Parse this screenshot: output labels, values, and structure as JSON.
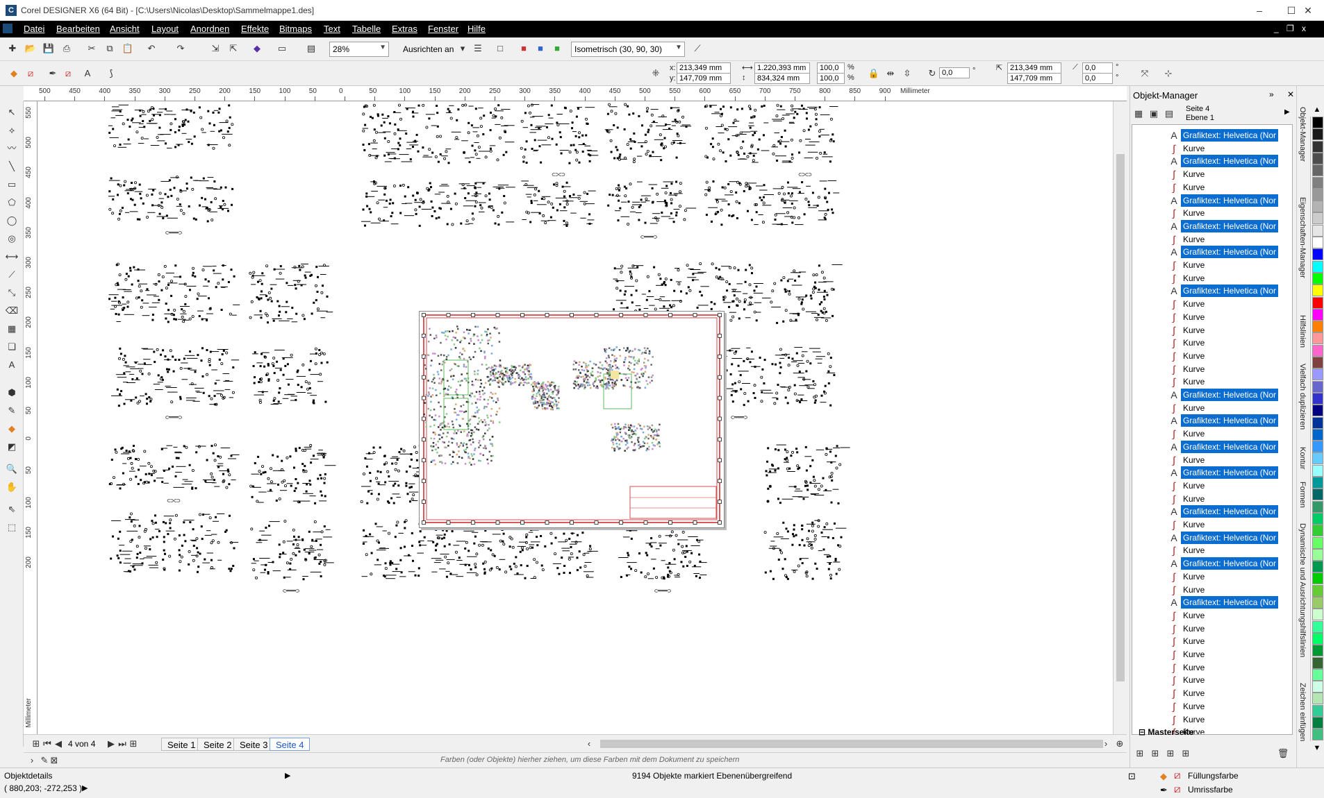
{
  "app": {
    "title": "Corel DESIGNER X6 (64 Bit) - [C:\\Users\\Nicolas\\Desktop\\Sammelmappe1.des]",
    "logo": "corel-logo"
  },
  "window_controls": {
    "minimize": "–",
    "maximize": "☐",
    "close": "✕"
  },
  "mdi_controls": {
    "minimize": "_",
    "restore": "❐",
    "close": "x"
  },
  "menu": [
    {
      "label": "Datei"
    },
    {
      "label": "Bearbeiten"
    },
    {
      "label": "Ansicht"
    },
    {
      "label": "Layout"
    },
    {
      "label": "Anordnen"
    },
    {
      "label": "Effekte"
    },
    {
      "label": "Bitmaps"
    },
    {
      "label": "Text"
    },
    {
      "label": "Tabelle"
    },
    {
      "label": "Extras"
    },
    {
      "label": "Fenster"
    },
    {
      "label": "Hilfe"
    }
  ],
  "toolbar": {
    "zoom": "28%",
    "align_label": "Ausrichten an",
    "projection": "Isometrisch (30, 90, 30)"
  },
  "propbar": {
    "x": "213,349 mm",
    "y": "147,709 mm",
    "width": "1.220,393 mm",
    "height": "834,324 mm",
    "scale_x": "100,0",
    "scale_y": "100,0",
    "percent": "%",
    "rotation": "0,0",
    "degree": "°",
    "pos2_x": "213,349 mm",
    "pos2_y": "147,709 mm",
    "skew_x": "0,0",
    "skew_y": "0,0",
    "x_label": "x:",
    "y_label": "y:"
  },
  "ruler": {
    "h_labels": [
      "500",
      "450",
      "400",
      "350",
      "300",
      "250",
      "200",
      "150",
      "100",
      "50",
      "0",
      "50",
      "100",
      "150",
      "200",
      "250",
      "300",
      "350",
      "400",
      "450",
      "500",
      "550",
      "600",
      "650",
      "700",
      "750",
      "800",
      "850",
      "900"
    ],
    "h_unit": "Millimeter",
    "v_labels": [
      "550",
      "500",
      "450",
      "400",
      "350",
      "300",
      "250",
      "200",
      "150",
      "100",
      "50",
      "0",
      "50",
      "100",
      "150",
      "200"
    ],
    "v_unit": "Millimeter"
  },
  "canvas": {
    "frame_labels": {
      "stub_a": "⊂⊃⊂⊃",
      "stub_b": "⊂═══⊃"
    }
  },
  "page_nav": {
    "counter": "4 von 4",
    "tabs": [
      {
        "label": "Seite 1"
      },
      {
        "label": "Seite 2"
      },
      {
        "label": "Seite 3"
      },
      {
        "label": "Seite 4",
        "active": true
      }
    ]
  },
  "colorwell": {
    "hint": "Farben (oder Objekte) hierher ziehen, um diese Farben mit dem Dokument zu speichern"
  },
  "status": {
    "object_details": "Objektdetails",
    "cursor": "( 880,203; -272,253 )",
    "selection": "9194 Objekte markiert Ebenenübergreifend",
    "fill_label": "Füllungsfarbe",
    "outline_label": "Umrissfarbe"
  },
  "docker": {
    "title": "Objekt-Manager",
    "page": "Seite 4",
    "layer": "Ebene 1",
    "nodes": [
      {
        "type": "text",
        "label": "Grafiktext: Helvetica (Nor"
      },
      {
        "type": "curve",
        "label": "Kurve"
      },
      {
        "type": "text",
        "label": "Grafiktext: Helvetica (Nor"
      },
      {
        "type": "curve",
        "label": "Kurve"
      },
      {
        "type": "curve",
        "label": "Kurve"
      },
      {
        "type": "text",
        "label": "Grafiktext: Helvetica (Nor"
      },
      {
        "type": "curve",
        "label": "Kurve"
      },
      {
        "type": "text",
        "label": "Grafiktext: Helvetica (Nor"
      },
      {
        "type": "curve",
        "label": "Kurve"
      },
      {
        "type": "text",
        "label": "Grafiktext: Helvetica (Nor"
      },
      {
        "type": "curve",
        "label": "Kurve"
      },
      {
        "type": "curve",
        "label": "Kurve"
      },
      {
        "type": "text",
        "label": "Grafiktext: Helvetica (Nor"
      },
      {
        "type": "curve",
        "label": "Kurve"
      },
      {
        "type": "curve",
        "label": "Kurve"
      },
      {
        "type": "curve",
        "label": "Kurve"
      },
      {
        "type": "curve",
        "label": "Kurve"
      },
      {
        "type": "curve",
        "label": "Kurve"
      },
      {
        "type": "curve",
        "label": "Kurve"
      },
      {
        "type": "curve",
        "label": "Kurve"
      },
      {
        "type": "text",
        "label": "Grafiktext: Helvetica (Nor"
      },
      {
        "type": "curve",
        "label": "Kurve"
      },
      {
        "type": "text",
        "label": "Grafiktext: Helvetica (Nor"
      },
      {
        "type": "curve",
        "label": "Kurve"
      },
      {
        "type": "text",
        "label": "Grafiktext: Helvetica (Nor"
      },
      {
        "type": "curve",
        "label": "Kurve"
      },
      {
        "type": "text",
        "label": "Grafiktext: Helvetica (Nor"
      },
      {
        "type": "curve",
        "label": "Kurve"
      },
      {
        "type": "curve",
        "label": "Kurve"
      },
      {
        "type": "text",
        "label": "Grafiktext: Helvetica (Nor"
      },
      {
        "type": "curve",
        "label": "Kurve"
      },
      {
        "type": "text",
        "label": "Grafiktext: Helvetica (Nor"
      },
      {
        "type": "curve",
        "label": "Kurve"
      },
      {
        "type": "text",
        "label": "Grafiktext: Helvetica (Nor"
      },
      {
        "type": "curve",
        "label": "Kurve"
      },
      {
        "type": "curve",
        "label": "Kurve"
      },
      {
        "type": "text",
        "label": "Grafiktext: Helvetica (Nor"
      },
      {
        "type": "curve",
        "label": "Kurve"
      },
      {
        "type": "curve",
        "label": "Kurve"
      },
      {
        "type": "curve",
        "label": "Kurve"
      },
      {
        "type": "curve",
        "label": "Kurve"
      },
      {
        "type": "curve",
        "label": "Kurve"
      },
      {
        "type": "curve",
        "label": "Kurve"
      },
      {
        "type": "curve",
        "label": "Kurve"
      },
      {
        "type": "curve",
        "label": "Kurve"
      },
      {
        "type": "curve",
        "label": "Kurve"
      },
      {
        "type": "curve",
        "label": "Kurve"
      }
    ],
    "master": "Masterseite"
  },
  "side_tabs": [
    "Objekt-Manager",
    "Eigenschaften-Manager",
    "Hilfslinien",
    "Vielfach duplizieren",
    "Kontur",
    "Formen",
    "Dynamische und Ausrichtungshilfslinien",
    "Zeichen einfügen"
  ],
  "palette": [
    "#000000",
    "#1a1a1a",
    "#333333",
    "#4d4d4d",
    "#666666",
    "#808080",
    "#999999",
    "#b3b3b3",
    "#cccccc",
    "#e6e6e6",
    "#ffffff",
    "#0000ff",
    "#00ffff",
    "#00ff00",
    "#ffff00",
    "#ff0000",
    "#ff00ff",
    "#ff8000",
    "#ff9999",
    "#ff66cc",
    "#804040",
    "#9999ff",
    "#6666cc",
    "#3333cc",
    "#000080",
    "#003399",
    "#0066cc",
    "#3399ff",
    "#66ccff",
    "#99ffff",
    "#009999",
    "#006666",
    "#339966",
    "#00cc66",
    "#33cc33",
    "#66ff66",
    "#99ff99",
    "#00994d",
    "#00cc00",
    "#66cc33",
    "#99cc66",
    "#ccffcc",
    "#33ff99",
    "#00ff66",
    "#009933",
    "#336633",
    "#66ff99",
    "#ccffe6",
    "#b3e6b3",
    "#33cc99",
    "#008040",
    "#40bf80"
  ],
  "colors": {
    "selection": "#0c6dd1",
    "menubar": "#000000",
    "page_border": "#cc2222"
  }
}
